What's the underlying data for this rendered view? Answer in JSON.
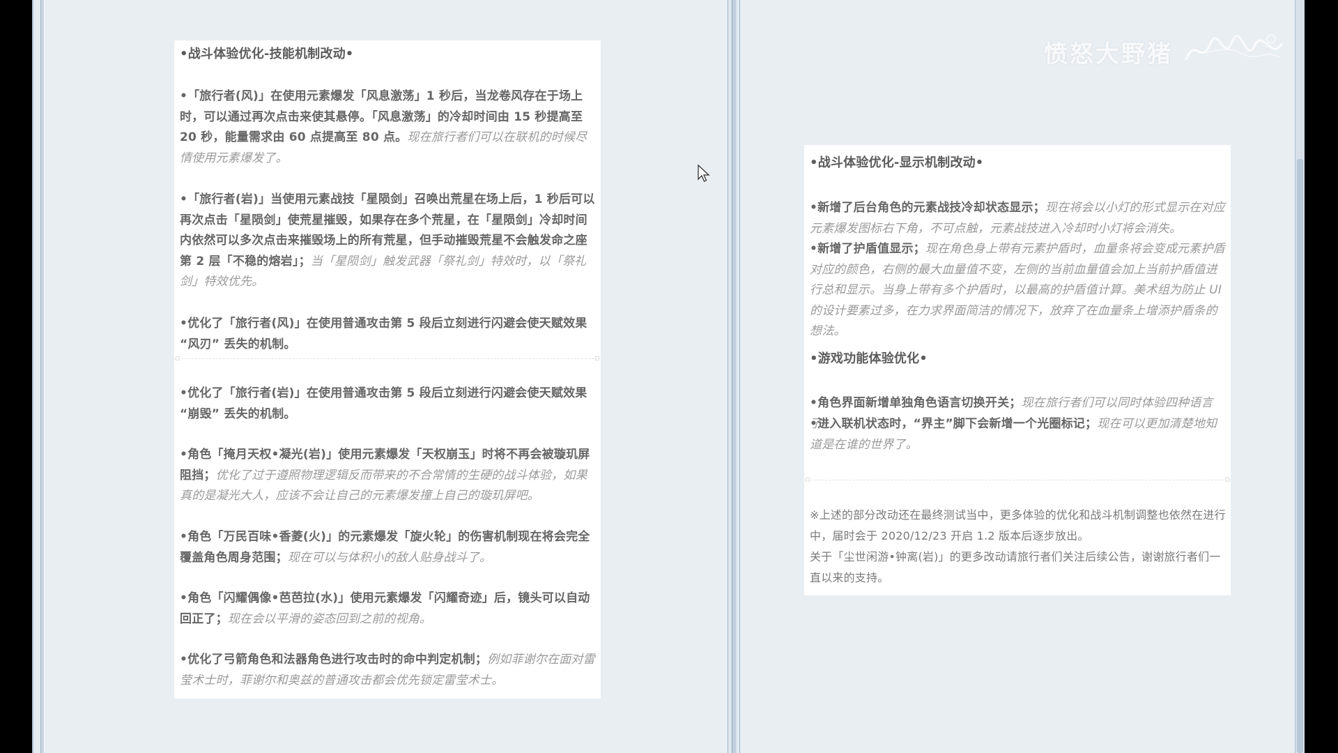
{
  "watermark": {
    "text": "愤怒大野猪"
  },
  "left_page": {
    "heading": "•战斗体验优化-技能机制改动•",
    "paragraphs": [
      {
        "bold": "•「旅行者(风)」在使用元素爆发「风息激荡」1 秒后，当龙卷风存在于场上时，可以通过再次点击来使其悬停。「风息激荡」的冷却时间由 15 秒提高至 20 秒，能量需求由 60 点提高至 80 点。",
        "note": "现在旅行者们可以在联机的时候尽情使用元素爆发了。"
      },
      {
        "bold": "•「旅行者(岩)」当使用元素战技「星陨剑」召唤出荒星在场上后，1 秒后可以再次点击「星陨剑」使荒星摧毁，如果存在多个荒星，在「星陨剑」冷却时间内依然可以多次点击来摧毁场上的所有荒星，但手动摧毁荒星不会触发命之座第 2 层「不稳的熔岩」；",
        "note": "当「星陨剑」触发武器「祭礼剑」特效时，以「祭礼剑」特效优先。"
      },
      {
        "bold": "•优化了「旅行者(风)」在使用普通攻击第 5 段后立刻进行闪避会使天赋效果 “风刃” 丢失的机制。",
        "note": ""
      },
      {
        "bold": "•优化了「旅行者(岩)」在使用普通攻击第 5 段后立刻进行闪避会使天赋效果 “崩毁” 丢失的机制。",
        "note": ""
      },
      {
        "bold": "•角色「掩月天权•凝光(岩)」使用元素爆发「天权崩玉」时将不再会被璇玑屏阻挡；",
        "note": "优化了过于遵照物理逻辑反而带来的不合常情的生硬的战斗体验，如果真的是凝光大人，应该不会让自己的元素爆发撞上自己的璇玑屏吧。"
      },
      {
        "bold": "•角色「万民百味•香菱(火)」的元素爆发「旋火轮」的伤害机制现在将会完全覆盖角色周身范围；",
        "note": "现在可以与体积小的敌人贴身战斗了。"
      },
      {
        "bold": "•角色「闪耀偶像•芭芭拉(水)」使用元素爆发「闪耀奇迹」后，镜头可以自动回正了；",
        "note": "现在会以平滑的姿态回到之前的视角。"
      },
      {
        "bold": "•优化了弓箭角色和法器角色进行攻击时的命中判定机制；",
        "note": "例如菲谢尔在面对雷莹术士时，菲谢尔和奥兹的普通攻击都会优先锁定雷莹术士。"
      }
    ]
  },
  "right_page": {
    "heading1": "•战斗体验优化-显示机制改动•",
    "section1": [
      {
        "bold": "•新增了后台角色的元素战技冷却状态显示；",
        "note": "现在将会以小灯的形式显示在对应元素爆发图标右下角，不可点触，元素战技进入冷却时小灯将会消失。"
      },
      {
        "bold": "•新增了护盾值显示；",
        "note": "现在角色身上带有元素护盾时，血量条将会变成元素护盾对应的颜色，右侧的最大血量值不变，左侧的当前血量值会加上当前护盾值进行总和显示。当身上带有多个护盾时，以最高的护盾值计算。美术组为防止 UI 的设计要素过多，在力求界面简洁的情况下，放弃了在血量条上增添护盾条的想法。"
      }
    ],
    "heading2": "•游戏功能体验优化•",
    "section2": [
      {
        "bold": "•角色界面新增单独角色语言切换开关；",
        "note": "现在旅行者们可以同时体验四种语言了。"
      },
      {
        "bold": "•进入联机状态时，“界主”脚下会新增一个光圈标记；",
        "note": "现在可以更加清楚地知道是在谁的世界了。"
      }
    ],
    "footer": [
      "※上述的部分改动还在最终测试当中，更多体验的优化和战斗机制调整也依然在进行中，届时会于 2020/12/23 开启 1.2 版本后逐步放出。",
      "关于「尘世闲游•钟离(岩)」的更多改动请旅行者们关注后续公告，谢谢旅行者们一直以来的支持。"
    ]
  }
}
